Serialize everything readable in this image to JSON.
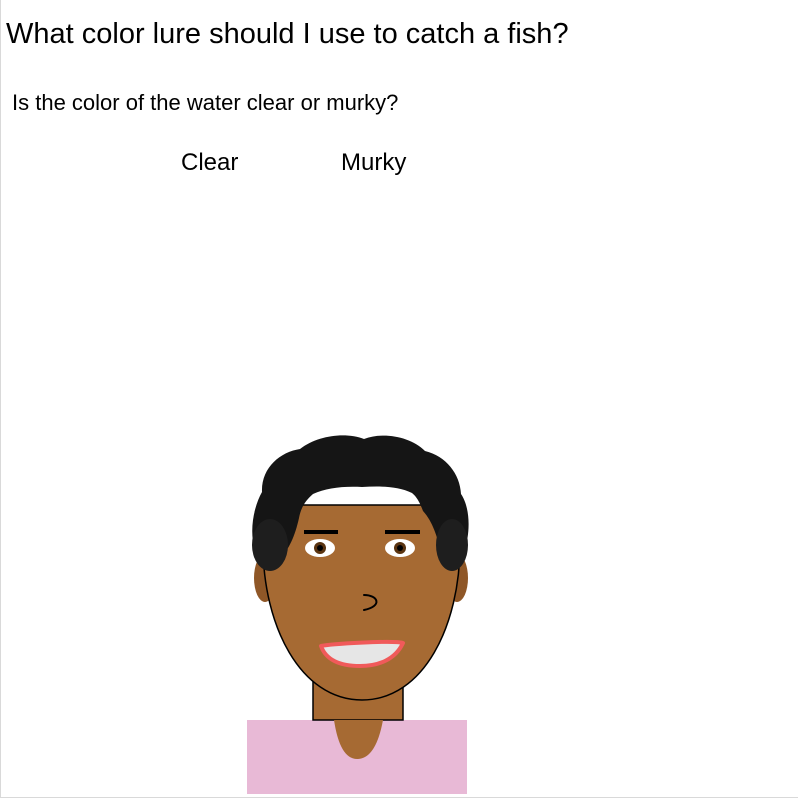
{
  "title": "What color lure should I use to catch a fish?",
  "question": "Is the color of the water clear or murky?",
  "choices": {
    "clear": "Clear",
    "murky": "Murky"
  },
  "avatar": {
    "skin_color": "#a66a33",
    "hair_color": "#151515",
    "shirt_color": "#e8b9d6",
    "lip_color": "#f05a5a"
  }
}
